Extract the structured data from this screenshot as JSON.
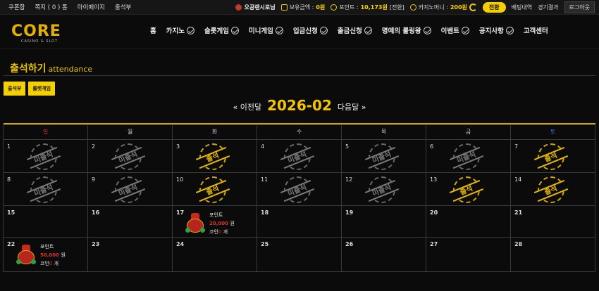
{
  "topbar": {
    "links": [
      "쿠폰함",
      "쪽지 ( 0 ) 통",
      "마이페이지",
      "출석부"
    ],
    "user": "오공렌시로님",
    "balance_label": "보유금액 :",
    "balance_value": "0원",
    "point_label": "포인트 :",
    "point_value": "10,173원",
    "point_suffix": "[전환]",
    "casino_label": "카지노머니 :",
    "casino_value": "200원",
    "convert_button": "전환",
    "bet_history": "배팅내역",
    "game_results": "경기결과",
    "logout": "로그아웃"
  },
  "logo": {
    "word": "CORE",
    "sub": "CASINO & SLOT"
  },
  "nav": [
    "홈",
    "카지노",
    "슬롯게임",
    "미니게임",
    "입금신청",
    "출금신청",
    "명예의 룰링왕",
    "이벤트",
    "공지사항",
    "고객센터"
  ],
  "page": {
    "title": "출석하기",
    "subtitle": "attendance"
  },
  "sub_buttons": [
    "출석부",
    "룰렛게임"
  ],
  "month_nav": {
    "prev": "« 이전달",
    "current": "2026-02",
    "next": "다음달 »"
  },
  "weekdays": [
    "일",
    "월",
    "화",
    "수",
    "목",
    "금",
    "토"
  ],
  "colors": {
    "accent": "#f5d000",
    "sunday": "#e03030",
    "saturday": "#3a7fd8"
  },
  "calendar": {
    "weeks": [
      [
        {
          "day": "1",
          "stamp": "미출석"
        },
        {
          "day": "2",
          "stamp": "미출석"
        },
        {
          "day": "3",
          "stamp": "출석"
        },
        {
          "day": "4",
          "stamp": "미출석"
        },
        {
          "day": "5",
          "stamp": "미출석"
        },
        {
          "day": "6",
          "stamp": "미출석"
        },
        {
          "day": "7",
          "stamp": "출석"
        }
      ],
      [
        {
          "day": "8",
          "stamp": "미출석"
        },
        {
          "day": "9",
          "stamp": "미출석"
        },
        {
          "day": "10",
          "stamp": "출석"
        },
        {
          "day": "11",
          "stamp": "미출석"
        },
        {
          "day": "12",
          "stamp": "미출석"
        },
        {
          "day": "13",
          "stamp": "출석"
        },
        {
          "day": "14",
          "stamp": "출석"
        }
      ],
      [
        {
          "day": "15"
        },
        {
          "day": "16"
        },
        {
          "day": "17",
          "prize": {
            "label": "포인트",
            "amount": "20,000",
            "unit": "원",
            "coin_label": "코인",
            "coin_count": "0",
            "coin_unit": "개"
          }
        },
        {
          "day": "18"
        },
        {
          "day": "19"
        },
        {
          "day": "20"
        },
        {
          "day": "21"
        }
      ],
      [
        {
          "day": "22",
          "prize": {
            "label": "포인트",
            "amount": "50,000",
            "unit": "원",
            "coin_label": "코인",
            "coin_count": "0",
            "coin_unit": "개"
          }
        },
        {
          "day": "23"
        },
        {
          "day": "24"
        },
        {
          "day": "25"
        },
        {
          "day": "26"
        },
        {
          "day": "27"
        },
        {
          "day": "28"
        }
      ]
    ]
  }
}
